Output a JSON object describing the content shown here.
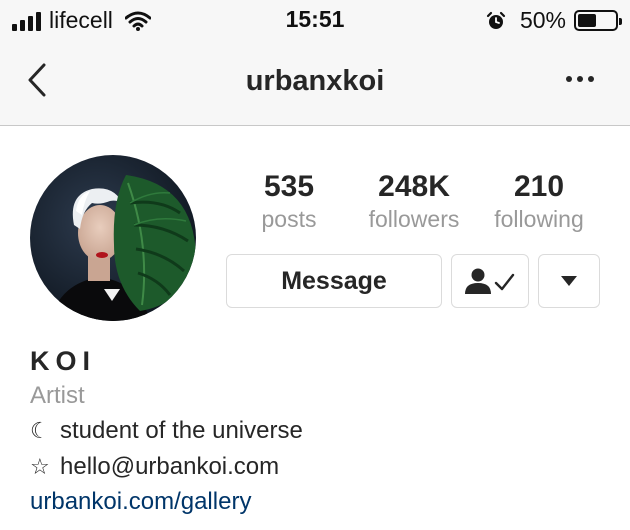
{
  "status_bar": {
    "carrier": "lifecell",
    "time": "15:51",
    "battery_percent": "50%",
    "battery_level": 0.5,
    "icons": [
      "signal-icon",
      "wifi-icon",
      "alarm-icon",
      "battery-icon"
    ]
  },
  "nav": {
    "title": "urbanxkoi",
    "back_icon": "chevron-left-icon",
    "more_icon": "more-horizontal-icon"
  },
  "profile": {
    "stats": [
      {
        "count": "535",
        "label": "posts"
      },
      {
        "count": "248K",
        "label": "followers"
      },
      {
        "count": "210",
        "label": "following"
      }
    ],
    "buttons": {
      "message": "Message",
      "following_icon": "person-check-icon",
      "dropdown_icon": "caret-down-icon"
    }
  },
  "bio": {
    "name": "KOI",
    "category": "Artist",
    "lines": [
      {
        "icon": "moon-icon",
        "glyph": "☾",
        "text": "student of the universe"
      },
      {
        "icon": "star-outline-icon",
        "glyph": "☆",
        "text": "hello@urbankoi.com"
      }
    ],
    "link": "urbankoi.com/gallery"
  },
  "colors": {
    "text_primary": "#262626",
    "text_secondary": "#999999",
    "link": "#003569",
    "border": "#dbdbdb",
    "bar_background": "#f7f7f7"
  }
}
